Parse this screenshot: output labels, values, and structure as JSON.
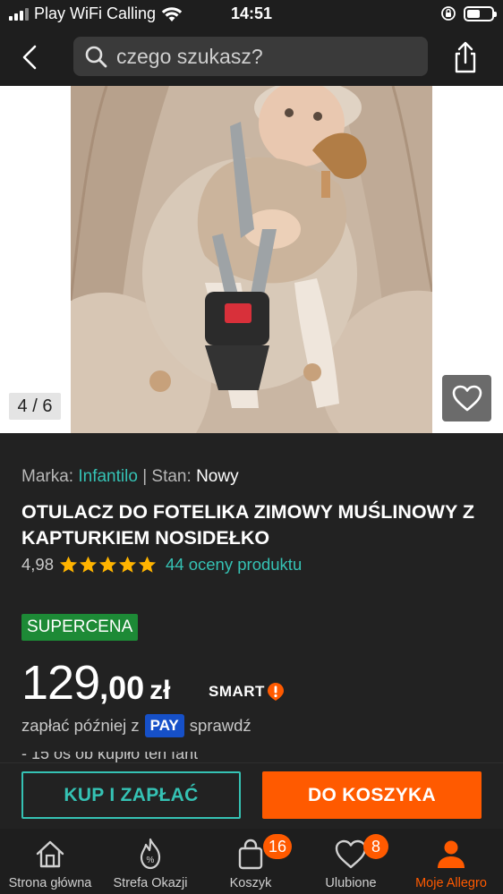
{
  "status_bar": {
    "carrier": "Play WiFi Calling",
    "time": "14:51"
  },
  "search": {
    "placeholder": "czego szukasz?"
  },
  "gallery": {
    "counter": "4 / 6"
  },
  "product": {
    "brand_label": "Marka:",
    "brand_value": "Infantilo",
    "separator": "|",
    "condition_label": "Stan:",
    "condition_value": "Nowy",
    "title": "OTULACZ DO FOTELIKA ZIMOWY MUŚLINOWY Z KAPTURKIEM NOSIDEŁKO",
    "rating_value": "4,98",
    "rating_stars": 5,
    "rating_count_text": "44 oceny produktu",
    "badge": "SUPERCENA",
    "price_int": "129",
    "price_dec": ",00",
    "price_currency": "zł",
    "smart_label": "SMART",
    "pay_later_text": "zapłać później z",
    "pay_badge": "PAY",
    "pay_link": "sprawdź",
    "cut_text": "- 15 os ób kupiło ten fant"
  },
  "actions": {
    "buy_now": "KUP I ZAPŁAĆ",
    "add_to_cart": "DO KOSZYKA"
  },
  "tabs": [
    {
      "label": "Strona główna"
    },
    {
      "label": "Strefa Okazji"
    },
    {
      "label": "Koszyk",
      "badge": "16"
    },
    {
      "label": "Ulubione",
      "badge": "8"
    },
    {
      "label": "Moje Allegro"
    }
  ],
  "colors": {
    "accent_teal": "#35c2b4",
    "accent_orange": "#ff5a00",
    "badge_green": "#1d8a36",
    "pay_blue": "#1650c8",
    "background": "#222222"
  }
}
